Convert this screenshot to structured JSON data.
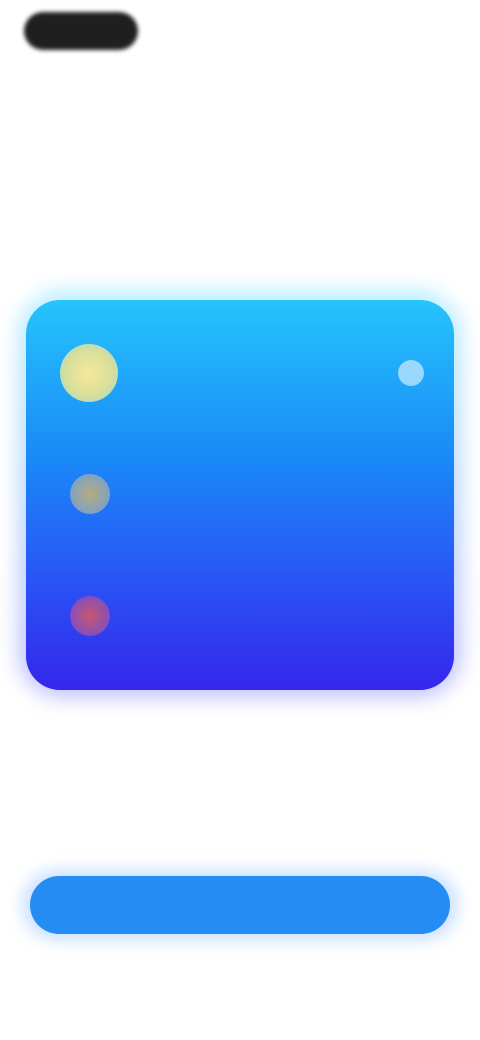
{
  "header": {
    "tabs": [
      {
        "label": "",
        "active": true
      },
      {
        "label": "",
        "active": false
      },
      {
        "label": "",
        "active": false
      }
    ]
  },
  "main": {
    "headline": "",
    "card": {
      "items": [
        {
          "title": "",
          "subtitle": "",
          "badge_color": "#e6e39f"
        },
        {
          "title": "",
          "subtitle": "",
          "badge_color": "#9aa3a8"
        },
        {
          "title": "",
          "subtitle": "",
          "badge_color": "#a5527f"
        }
      ],
      "gradient_top": "#26c4fb",
      "gradient_bottom": "#3526ea"
    },
    "caption": ""
  },
  "footer": {
    "button_label": "",
    "button_color": "#258cf4"
  }
}
